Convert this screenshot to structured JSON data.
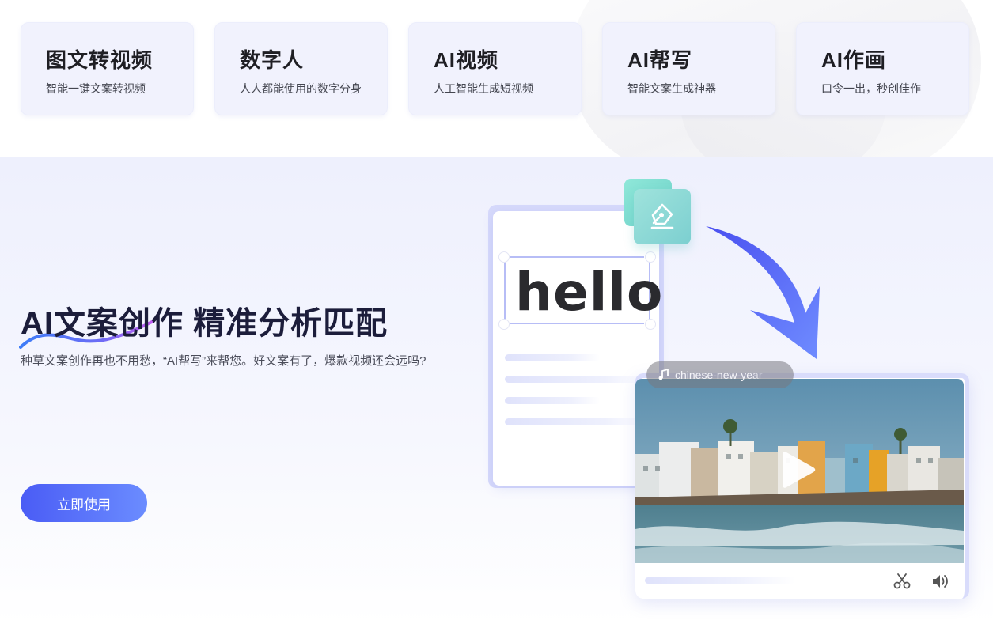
{
  "feature_cards": [
    {
      "title": "图文转视频",
      "subtitle": "智能一键文案转视频"
    },
    {
      "title": "数字人",
      "subtitle": "人人都能使用的数字分身"
    },
    {
      "title": "AI视频",
      "subtitle": "人工智能生成短视频"
    },
    {
      "title": "AI帮写",
      "subtitle": "智能文案生成神器"
    },
    {
      "title": "AI作画",
      "subtitle": "口令一出，秒创佳作"
    }
  ],
  "hero": {
    "title": "AI文案创作 精准分析匹配",
    "description": "种草文案创作再也不用愁，“AI帮写”来帮您。好文案有了，爆款视频还会远吗?",
    "cta_label": "立即使用"
  },
  "illustration": {
    "doc_word": "hello",
    "music_track": "chinese-new-year",
    "icons": {
      "pen": "pen-nib-icon",
      "music": "music-note-icon",
      "play": "play-icon",
      "scissors": "scissors-icon",
      "volume": "volume-icon"
    }
  },
  "colors": {
    "accent": "#4a5cf5",
    "accent_light": "#6b8cff",
    "card_bg": "#f1f2fd",
    "hero_bg": "#eef0fd",
    "teal": "#7ccfd0"
  }
}
